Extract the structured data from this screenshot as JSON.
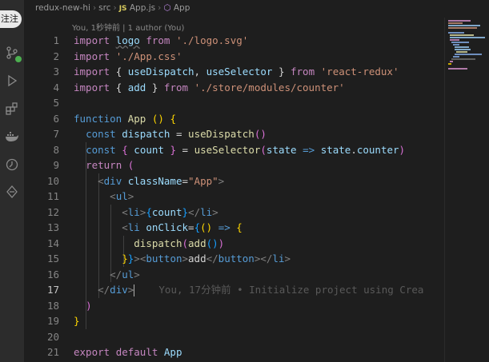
{
  "chip_label": "注注",
  "breadcrumb": {
    "folder": "redux-new-hi",
    "sub": "src",
    "lang": "JS",
    "file": "App.js",
    "symbol": "App"
  },
  "codelens": "You, 1秒钟前 | 1 author (You)",
  "blame": "You, 17分钟前 • Initialize project using Crea",
  "line_numbers": [
    "1",
    "2",
    "3",
    "4",
    "5",
    "6",
    "7",
    "8",
    "9",
    "10",
    "11",
    "12",
    "13",
    "14",
    "15",
    "16",
    "17",
    "18",
    "19",
    "20",
    "21"
  ],
  "tokens": {
    "import": "import",
    "from": "from",
    "logo": "logo",
    "logo_path": "'./logo.svg'",
    "css_path": "'./App.css'",
    "lbrace": "{",
    "rbrace": "}",
    "useDispatch": "useDispatch",
    "useSelector": "useSelector",
    "comma": ",",
    "react_redux": "'react-redux'",
    "add": "add",
    "store_path": "'./store/modules/counter'",
    "function": "function",
    "App": "App",
    "parens": "()",
    "const": "const",
    "dispatch": "dispatch",
    "eq": "=",
    "count": "count",
    "state": "state",
    "arrow": "=>",
    "dot": ".",
    "counter": "counter",
    "return": "return",
    "lparen": "(",
    "rparen": ")",
    "lt": "<",
    "gt": ">",
    "closelt": "</",
    "div": "div",
    "className": "className",
    "App_str": "\"App\"",
    "ul": "ul",
    "li": "li",
    "onClick": "onClick",
    "button": "button",
    "export": "export",
    "default": "default"
  }
}
